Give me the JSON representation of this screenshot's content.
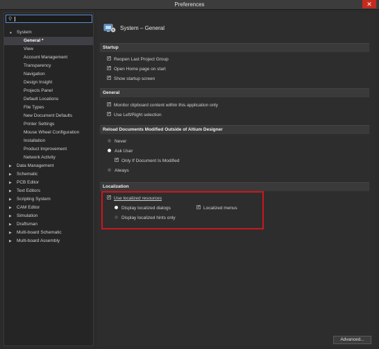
{
  "window": {
    "title": "Preferences",
    "close_glyph": "✕"
  },
  "search": {
    "value": ""
  },
  "tree": {
    "system_label": "System",
    "system_children": [
      "General *",
      "View",
      "Account Management",
      "Transparency",
      "Navigation",
      "Design Insight",
      "Projects Panel",
      "Default Locations",
      "File Types",
      "New Document Defaults",
      "Printer Settings",
      "Mouse Wheel Configuration",
      "Installation",
      "Product Improvement",
      "Network Activity"
    ],
    "top_items": [
      "Data Management",
      "Schematic",
      "PCB Editor",
      "Text Editors",
      "Scripting System",
      "CAM Editor",
      "Simulation",
      "Draftsman",
      "Multi-board Schematic",
      "Multi-board Assembly"
    ]
  },
  "page": {
    "title": "System – General"
  },
  "startup": {
    "header": "Startup",
    "reopen": "Reopen Last Project Group",
    "open_home": "Open Home page on start",
    "splash": "Show startup screen"
  },
  "general": {
    "header": "General",
    "monitor_clipboard": "Monitor clipboard content within this application only",
    "left_right": "Use Left/Right selection"
  },
  "reload": {
    "header": "Reload Documents Modified Outside of Altium Designer",
    "never": "Never",
    "ask_user": "Ask User",
    "only_if_modified": "Only If Document Is Modified",
    "always": "Always"
  },
  "localization": {
    "header": "Localization",
    "use_localized": "Use localized resources",
    "display_dialogs": "Display localized dialogs",
    "localized_menus": "Localized menus",
    "display_hints": "Display localized hints only"
  },
  "footer": {
    "advanced": "Advanced..."
  }
}
